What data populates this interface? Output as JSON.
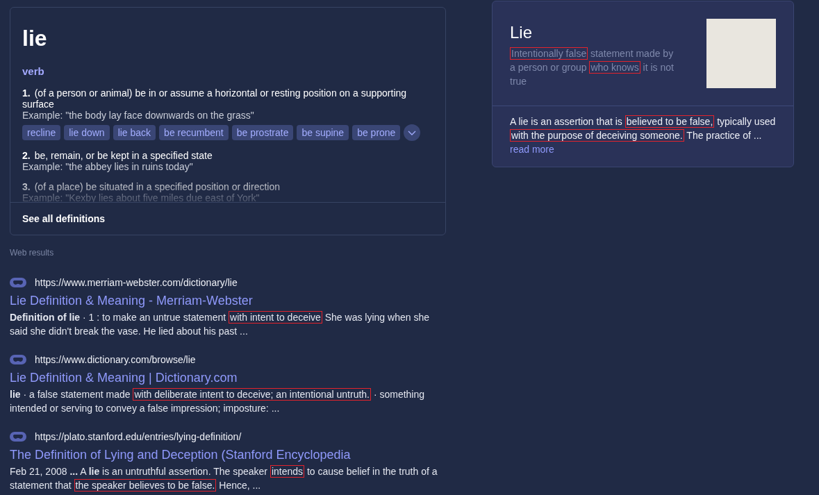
{
  "definition_card": {
    "word": "lie",
    "part_of_speech": "verb",
    "senses": [
      {
        "number": "1.",
        "definition": "(of a person or animal) be in or assume a horizontal or resting position on a supporting surface",
        "example": "Example: \"the body lay face downwards on the grass\"",
        "synonyms": [
          "recline",
          "lie down",
          "lie back",
          "be recumbent",
          "be prostrate",
          "be supine",
          "be prone"
        ]
      },
      {
        "number": "2.",
        "definition": "be, remain, or be kept in a specified state",
        "example": "Example: \"the abbey lies in ruins today\""
      },
      {
        "number": "3.",
        "definition": "(of a place) be situated in a specified position or direction",
        "example": "Example: \"Kexby lies about five miles due east of York\""
      }
    ],
    "see_all": "See all definitions"
  },
  "web_results": {
    "heading": "Web results",
    "results": [
      {
        "url": "https://www.merriam-webster.com/dictionary/lie",
        "title": "Lie Definition & Meaning - Merriam-Webster",
        "snippet": [
          {
            "text": "**Definition of lie** · 1 : to make an untrue statement ",
            "boxed": false
          },
          {
            "text": "with intent to deceive",
            "boxed": true
          },
          {
            "text": " She was lying when she said she didn't break the vase. He lied about his past ...",
            "boxed": false
          }
        ]
      },
      {
        "url": "https://www.dictionary.com/browse/lie",
        "title": "Lie Definition & Meaning | Dictionary.com",
        "snippet": [
          {
            "text": "**lie** · a false statement made ",
            "boxed": false
          },
          {
            "text": "with deliberate intent to deceive; an intentional untruth.",
            "boxed": true
          },
          {
            "text": " · something intended or serving to convey a false impression; imposture: ...",
            "boxed": false
          }
        ]
      },
      {
        "url": "https://plato.stanford.edu/entries/lying-definition/",
        "title": "The Definition of Lying and Deception (Stanford Encyclopedia",
        "snippet": [
          {
            "text": "Feb 21, 2008 **...** A **lie** is an untruthful assertion. The speaker ",
            "boxed": false
          },
          {
            "text": "intends",
            "boxed": true
          },
          {
            "text": " to cause belief in the truth of a statement that ",
            "boxed": false
          },
          {
            "text": "the speaker believes to be false.",
            "boxed": true
          },
          {
            "text": " Hence, ...",
            "boxed": false
          }
        ]
      }
    ]
  },
  "knowledge_panel": {
    "title": "Lie",
    "description": [
      {
        "text": "Intentionally false",
        "boxed": true
      },
      {
        "text": " statement made by a person or group ",
        "boxed": false
      },
      {
        "text": "who knows",
        "boxed": true
      },
      {
        "text": " it is not true",
        "boxed": false
      }
    ],
    "summary": [
      {
        "text": "A lie is an assertion that is ",
        "boxed": false
      },
      {
        "text": "believed to be false,",
        "boxed": true
      },
      {
        "text": " typically used ",
        "boxed": false
      },
      {
        "text": "with the purpose of deceiving someone.",
        "boxed": true
      },
      {
        "text": " The practice of ...",
        "boxed": false
      }
    ],
    "read_more": "read more"
  }
}
